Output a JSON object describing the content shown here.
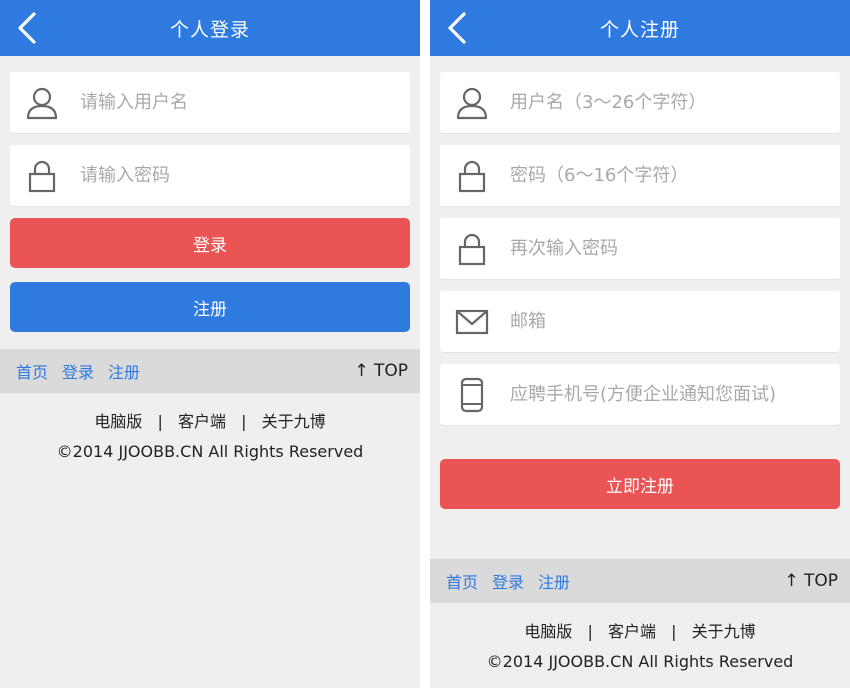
{
  "login": {
    "title": "个人登录",
    "username_placeholder": "请输入用户名",
    "password_placeholder": "请输入密码",
    "login_button": "登录",
    "register_button": "注册",
    "nav": {
      "home": "首页",
      "login": "登录",
      "register": "注册",
      "top": "↑ TOP"
    },
    "links": {
      "pc": "电脑版",
      "sep": "|",
      "client": "客户端",
      "about": "关于九博"
    },
    "copyright": "©2014 JJOOBB.CN All Rights Reserved"
  },
  "register": {
    "title": "个人注册",
    "username_placeholder": "用户名（3～26个字符）",
    "password_placeholder": "密码（6～16个字符）",
    "confirm_placeholder": "再次输入密码",
    "email_placeholder": "邮箱",
    "phone_placeholder": "应聘手机号(方便企业通知您面试)",
    "submit_button": "立即注册",
    "nav": {
      "home": "首页",
      "login": "登录",
      "register": "注册",
      "top": "↑ TOP"
    },
    "links": {
      "pc": "电脑版",
      "sep": "|",
      "client": "客户端",
      "about": "关于九博"
    },
    "copyright": "©2014 JJOOBB.CN All Rights Reserved"
  },
  "colors": {
    "accent": "#2f7adf",
    "danger": "#eb5454",
    "background": "#efefef"
  },
  "icons": [
    "back-chevron-icon",
    "user-icon",
    "lock-icon",
    "mail-icon",
    "phone-icon"
  ]
}
